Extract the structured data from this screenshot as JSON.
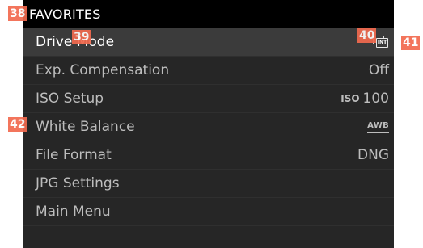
{
  "header": {
    "title": "FAVORITES"
  },
  "menu": {
    "items": [
      {
        "label": "Drive Mode",
        "value": ""
      },
      {
        "label": "Exp. Compensation",
        "value": "Off"
      },
      {
        "label": "ISO Setup",
        "value_prefix": "ISO",
        "value": "100"
      },
      {
        "label": "White Balance",
        "value": "AWB"
      },
      {
        "label": "File Format",
        "value": "DNG"
      },
      {
        "label": "JPG Settings",
        "value": ""
      },
      {
        "label": "Main Menu",
        "value": ""
      }
    ],
    "drive_mode_icon": {
      "name": "continuous-interval-icon",
      "text": "INT"
    }
  },
  "annotations": {
    "badge_38": "38",
    "badge_39": "39",
    "badge_40": "40",
    "badge_41": "41",
    "badge_42": "42"
  },
  "colors": {
    "background": "#262626",
    "header_background": "#000000",
    "selected_row": "#3b3b3b",
    "text": "#bdbdbd",
    "selected_text": "#ffffff",
    "badge": "#f26a4f"
  }
}
